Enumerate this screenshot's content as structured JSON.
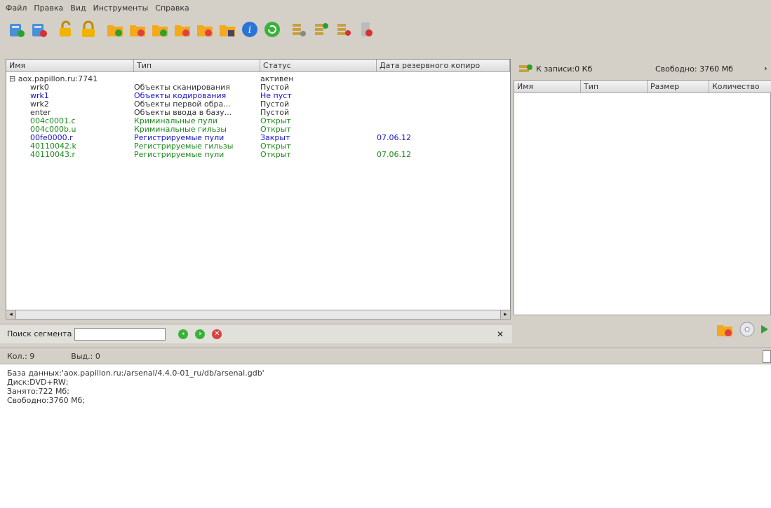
{
  "menu": [
    "Файл",
    "Правка",
    "Вид",
    "Инструменты",
    "Справка"
  ],
  "toolbar_icons": [
    "server-add-icon",
    "server-remove-icon",
    "unlock-icon",
    "lock-icon",
    "folder-add-icon",
    "folder-remove-icon",
    "folder-edit-icon",
    "folder-delete-icon",
    "folder-copy-icon",
    "folder-save-icon",
    "info-icon",
    "refresh-icon",
    "db-settings-icon",
    "db-add-icon",
    "db-remove-icon",
    "disk-remove-icon"
  ],
  "left_columns": {
    "name": "Имя",
    "type": "Тип",
    "status": "Статус",
    "backup_date": "Дата резервного копиро"
  },
  "tree": [
    {
      "name": "aox.papillon.ru:7741",
      "type": "",
      "status": "активен",
      "date": "",
      "color": "black",
      "indent": 0
    },
    {
      "name": "wrk0",
      "type": "Объекты сканирования",
      "status": "Пустой",
      "date": "",
      "color": "black",
      "indent": 1
    },
    {
      "name": "wrk1",
      "type": "Объекты кодирования",
      "status": "Не пуст",
      "date": "",
      "color": "blue",
      "indent": 1
    },
    {
      "name": "wrk2",
      "type": "Объекты первой обра...",
      "status": "Пустой",
      "date": "",
      "color": "black",
      "indent": 1
    },
    {
      "name": "enter",
      "type": "Объекты ввода в базу...",
      "status": "Пустой",
      "date": "",
      "color": "black",
      "indent": 1
    },
    {
      "name": "004c0001.c",
      "type": "Криминальные пули",
      "status": "Открыт",
      "date": "",
      "color": "green",
      "indent": 1
    },
    {
      "name": "004c000b.u",
      "type": "Криминальные гильзы",
      "status": "Открыт",
      "date": "",
      "color": "green",
      "indent": 1
    },
    {
      "name": "00fe0000.r",
      "type": "Регистрируемые пули",
      "status": "Закрыт",
      "date": "07.06.12",
      "color": "blue",
      "indent": 1
    },
    {
      "name": "40110042.k",
      "type": "Регистрируемые гильзы",
      "status": "Открыт",
      "date": "",
      "color": "green",
      "indent": 1
    },
    {
      "name": "40110043.r",
      "type": "Регистрируемые пули",
      "status": "Открыт",
      "date": "07.06.12",
      "color": "green",
      "indent": 1
    }
  ],
  "right_header": {
    "to_write": "К записи:0 Кб",
    "free": "Свободно: 3760 Мб"
  },
  "right_columns": {
    "name": "Имя",
    "type": "Тип",
    "size": "Размер",
    "count": "Количество"
  },
  "search": {
    "label": "Поиск сегмента",
    "value": ""
  },
  "status": {
    "count": "Кол.: 9",
    "selected": "Выд.: 0"
  },
  "info_lines": [
    "База данных:'aox.papillon.ru:/arsenal/4.4.0-01_ru/db/arsenal.gdb'",
    "Диск:DVD+RW;",
    "Занято:722 Мб;",
    "Свободно:3760 Мб;"
  ]
}
